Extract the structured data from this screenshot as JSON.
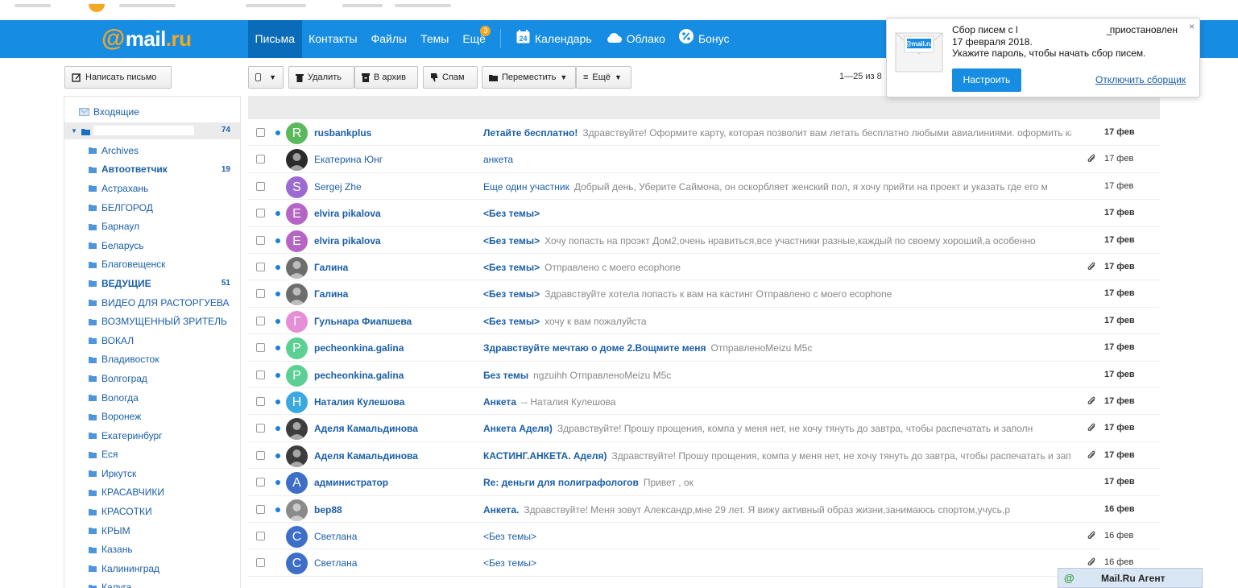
{
  "header": {
    "logo_at": "@",
    "logo_mail": "mail",
    "logo_ru": ".ru",
    "nav": [
      {
        "label": "Письма",
        "active": true
      },
      {
        "label": "Контакты"
      },
      {
        "label": "Файлы"
      },
      {
        "label": "Темы"
      },
      {
        "label": "Ещё",
        "badge": "3"
      }
    ],
    "services": [
      {
        "label": "Календарь",
        "icon": "calendar-icon",
        "icon_text": "24"
      },
      {
        "label": "Облако",
        "icon": "cloud-icon"
      },
      {
        "label": "Бонус",
        "icon": "percent-icon"
      }
    ]
  },
  "toolbar": {
    "compose_label": "Написать письмо",
    "delete_label": "Удалить",
    "archive_label": "В архив",
    "spam_label": "Спам",
    "move_label": "Переместить",
    "more_label": "Ещё",
    "pager_text": "1—25 из 8"
  },
  "sidebar": {
    "inbox_label": "Входящие",
    "account_count": "74",
    "folders": [
      {
        "label": "Archives"
      },
      {
        "label": "Автоответчик",
        "bold": true,
        "count": "19"
      },
      {
        "label": "Астрахань"
      },
      {
        "label": "БЕЛГОРОД"
      },
      {
        "label": "Барнаул"
      },
      {
        "label": "Беларусь"
      },
      {
        "label": "Благовещенск"
      },
      {
        "label": "ВЕДУЩИЕ",
        "bold": true,
        "count": "51"
      },
      {
        "label": "ВИДЕО ДЛЯ РАСТОРГУЕВА"
      },
      {
        "label": "ВОЗМУЩЕННЫЙ ЗРИТЕЛЬ"
      },
      {
        "label": "ВОКАЛ"
      },
      {
        "label": "Владивосток"
      },
      {
        "label": "Волгоград"
      },
      {
        "label": "Вологда"
      },
      {
        "label": "Воронеж"
      },
      {
        "label": "Екатеринбург"
      },
      {
        "label": "Еся"
      },
      {
        "label": "Иркутск"
      },
      {
        "label": "КРАСАВЧИКИ"
      },
      {
        "label": "КРАСОТКИ"
      },
      {
        "label": "КРЫМ"
      },
      {
        "label": "Казань"
      },
      {
        "label": "Калининград"
      },
      {
        "label": "Калуга"
      }
    ]
  },
  "messages": [
    {
      "sender": "rusbankplus",
      "avatar": "R",
      "avatar_color": "#5cb85c",
      "subject": "Летайте бесплатно!",
      "preview": "Здравствуйте! Оформите карту, которая позволит вам летать бесплатно любыми авиалиниями. оформить кар",
      "date": "17 фев",
      "unread": true,
      "attach": false
    },
    {
      "sender": "Екатерина Юнг",
      "avatar": "",
      "avatar_color": "#2b2b2b",
      "subject": "анкета",
      "preview": "",
      "date": "17 фев",
      "unread": false,
      "attach": true
    },
    {
      "sender": "Sergej Zhe",
      "avatar": "S",
      "avatar_color": "#9b6bd1",
      "subject": "Еще один участник",
      "preview": "Добрый день, Уберите Саймона, он оскорбляет женский пол, я хочу прийти на проект и указать где его м",
      "date": "17 фев",
      "unread": false,
      "attach": false
    },
    {
      "sender": "elvira pikalova",
      "avatar": "E",
      "avatar_color": "#b565c4",
      "subject": "<Без темы>",
      "preview": "",
      "date": "17 фев",
      "unread": true,
      "attach": false
    },
    {
      "sender": "elvira pikalova",
      "avatar": "E",
      "avatar_color": "#b565c4",
      "subject": "<Без темы>",
      "preview": "Хочу попасть на проэкт Дом2,очень нравиться,все участники разные,каждый по своему хороший,а особенно",
      "date": "17 фев",
      "unread": true,
      "attach": false
    },
    {
      "sender": "Галина",
      "avatar": "",
      "avatar_color": "#6d6d6d",
      "subject": "<Без темы>",
      "preview": "Отправлено с моего ecophone",
      "date": "17 фев",
      "unread": true,
      "attach": true
    },
    {
      "sender": "Галина",
      "avatar": "",
      "avatar_color": "#6d6d6d",
      "subject": "<Без темы>",
      "preview": "Здравствуйте хотела попасть к вам на кастинг Отправлено с моего ecophone",
      "date": "17 фев",
      "unread": true,
      "attach": false
    },
    {
      "sender": "Гульнара Фиапшева",
      "avatar": "Г",
      "avatar_color": "#e58fd6",
      "subject": "<Без темы>",
      "preview": "хочу к вам пожалуйста",
      "date": "17 фев",
      "unread": true,
      "attach": false
    },
    {
      "sender": "pecheonkina.galina",
      "avatar": "P",
      "avatar_color": "#5ccf94",
      "subject": "Здравствуйте мечтаю о доме 2.Вощмите меня",
      "preview": "ОтправленоMeizu M5c",
      "date": "17 фев",
      "unread": true,
      "attach": false
    },
    {
      "sender": "pecheonkina.galina",
      "avatar": "P",
      "avatar_color": "#5ccf94",
      "subject": "Без темы",
      "preview": "ngzuihh ОтправленоMeizu M5c",
      "date": "17 фев",
      "unread": true,
      "attach": false
    },
    {
      "sender": "Наталия Кулешова",
      "avatar": "Н",
      "avatar_color": "#3aa9e0",
      "subject": "Анкета",
      "preview": "-- Наталия Кулешова",
      "date": "17 фев",
      "unread": true,
      "attach": true
    },
    {
      "sender": "Аделя Камальдинова",
      "avatar": "",
      "avatar_color": "#3c3c3c",
      "subject": "Анкета Аделя)",
      "preview": "Здравствуйте! Прошу прощения, компа у меня нет, не хочу тянуть до завтра, чтобы распечатать и заполн",
      "date": "17 фев",
      "unread": true,
      "attach": true
    },
    {
      "sender": "Аделя Камальдинова",
      "avatar": "",
      "avatar_color": "#3c3c3c",
      "subject": "КАСТИНГ.АНКЕТА. Аделя)",
      "preview": "Здравствуйте! Прошу прощения, компа у меня нет, не хочу тянуть до завтра, чтобы распечатать и запол",
      "date": "17 фев",
      "unread": true,
      "attach": true
    },
    {
      "sender": "администратор",
      "avatar": "A",
      "avatar_color": "#3d6fc9",
      "subject": "Re: деньги для полиграфологов",
      "preview": "Привет , ок",
      "date": "17 фев",
      "unread": true,
      "attach": false
    },
    {
      "sender": "bep88",
      "avatar": "",
      "avatar_color": "#8a8a8a",
      "subject": "Анкета.",
      "preview": "Здравствуйте! Меня зовут Александр,мне 29 лет. Я вижу активный образ жизни,занимаюсь спортом,учусь,р",
      "date": "16 фев",
      "unread": true,
      "attach": false
    },
    {
      "sender": "Светлана",
      "avatar": "С",
      "avatar_color": "#3d6fc9",
      "subject": "<Без темы>",
      "preview": "",
      "date": "16 фев",
      "unread": false,
      "attach": true
    },
    {
      "sender": "Светлана",
      "avatar": "С",
      "avatar_color": "#3d6fc9",
      "subject": "<Без темы>",
      "preview": "",
      "date": "16 фев",
      "unread": false,
      "attach": true
    }
  ],
  "popup": {
    "line1_a": "Сбор писем с l",
    "line1_b": "_",
    "line1_c": "приостановлен",
    "line2": "17 февраля 2018.",
    "line3": "Укажите пароль, чтобы начать сбор писем.",
    "setup_label": "Настроить",
    "disable_label": "Отключить сборщик",
    "close_glyph": "×",
    "logo_text": "@mail.ru"
  },
  "agent": {
    "icon_glyph": "@",
    "label": "Mail.Ru Агент"
  },
  "colors": {
    "header_bg": "#168de2",
    "nav_active": "#0a6bb9",
    "accent_orange": "#f5a623",
    "link_blue": "#1a5ea8"
  }
}
